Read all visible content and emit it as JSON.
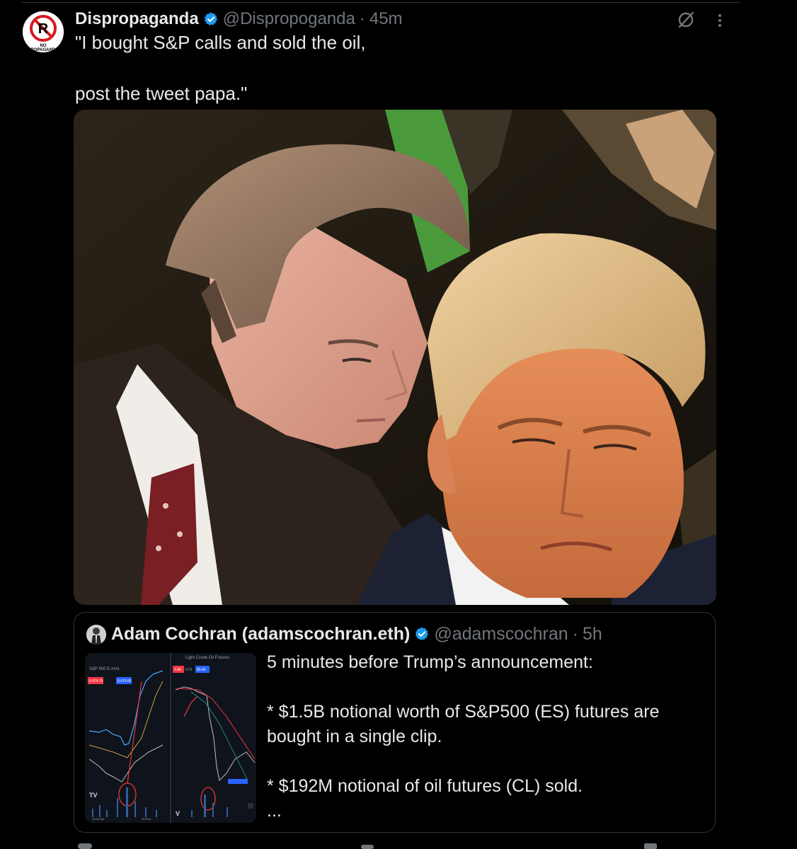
{
  "post": {
    "author_name": "Dispropaganda",
    "author_handle": "@Dispropoganda",
    "separator": "·",
    "time": "45m",
    "text_lines": [
      "\"I bought S&P calls and sold the oil,",
      "",
      "post the tweet papa.\""
    ],
    "avatar_logo_text": "NO PROPAGANDA",
    "verified_icon": "verified-badge-icon",
    "media_description_icon": "photo"
  },
  "quote": {
    "author_name": "Adam Cochran (adamscochran.eth)",
    "author_handle": "@adamscochran",
    "separator": "·",
    "time": "5h",
    "text_lines": [
      "5 minutes before Trump’s announcement:",
      "",
      "* $1.5B notional worth of S&P500 (ES) futures are",
      "bought in a single clip.",
      "",
      "* $192M notional of oil futures (CL) sold.",
      "..."
    ],
    "chart_thumb": {
      "left_label": "S&P 500 E-mini",
      "right_label": "Light Crude Oil Futures",
      "time_left": "09:50 AM",
      "time_right": "09:00 A",
      "badges": [
        "6,474.75",
        "6,475.00",
        "3.46",
        "0.01",
        "89.42"
      ]
    }
  },
  "colors": {
    "background": "#000000",
    "text_primary": "#e7e9ea",
    "text_secondary": "#71767b",
    "verified": "#1d9bf0",
    "border": "#2f3336"
  }
}
